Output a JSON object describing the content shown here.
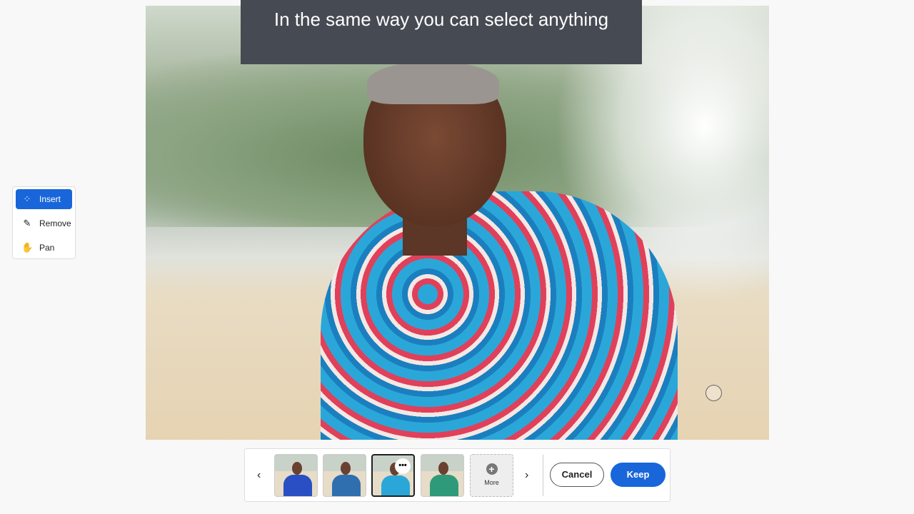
{
  "caption": "In the same way you can select anything",
  "tools": [
    {
      "label": "Insert",
      "icon": "sparkle-selection-icon",
      "active": true
    },
    {
      "label": "Remove",
      "icon": "bandage-eraser-icon"
    },
    {
      "label": "Pan",
      "icon": "hand-icon"
    }
  ],
  "variations": {
    "selected_index": 2,
    "more_label": "More",
    "count": 4
  },
  "buttons": {
    "cancel": "Cancel",
    "keep": "Keep"
  },
  "colors": {
    "accent": "#1866d9",
    "caption_bg": "#464a52"
  }
}
